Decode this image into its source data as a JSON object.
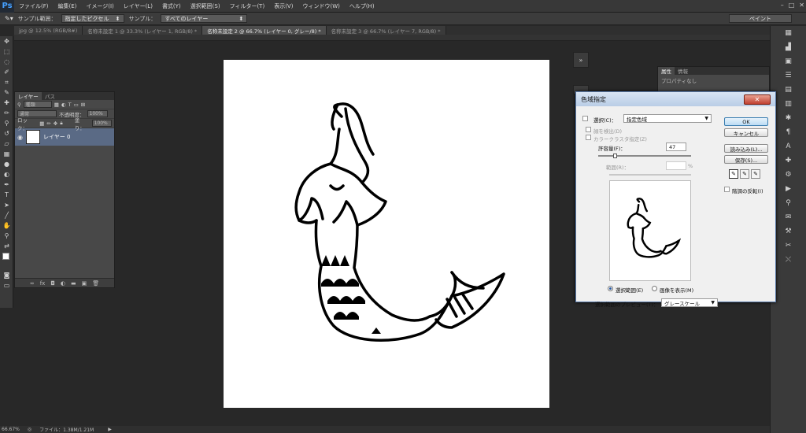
{
  "app": {
    "logo": "Ps"
  },
  "menu": [
    "ファイル(F)",
    "編集(E)",
    "イメージ(I)",
    "レイヤー(L)",
    "書式(Y)",
    "選択範囲(S)",
    "フィルター(T)",
    "表示(V)",
    "ウィンドウ(W)",
    "ヘルプ(H)"
  ],
  "options": {
    "sample_size_label": "サンプル範囲：",
    "sample_size_value": "指定したピクセル",
    "sample_label": "サンプル：",
    "sample_value": "すべてのレイヤー",
    "workspace": "ペイント"
  },
  "tabs": [
    {
      "label": "jpg @ 12.5% (RGB/8#)",
      "active": false
    },
    {
      "label": "名称未設定 1 @ 33.3% (レイヤー 1, RGB/8) *",
      "active": false
    },
    {
      "label": "名称未設定 2 @ 66.7% (レイヤー 0, グレー/8) *",
      "active": true
    },
    {
      "label": "名称未設定 3 @ 66.7% (レイヤー 7, RGB/8) *",
      "active": false
    }
  ],
  "layers_panel": {
    "tabs": [
      "レイヤー",
      "パス"
    ],
    "filter_label": "種類",
    "blend_mode": "通常",
    "opacity_label": "不透明度：",
    "opacity_value": "100%",
    "lock_label": "ロック：",
    "fill_label": "塗り：",
    "fill_value": "100%",
    "layer_name": "レイヤー 0",
    "footer_icons": [
      "link-icon",
      "fx-icon",
      "mask-icon",
      "adjustment-icon",
      "folder-icon",
      "new-layer-icon",
      "trash-icon"
    ]
  },
  "properties_panel": {
    "tabs": [
      "属性",
      "情報"
    ],
    "text": "プロパティなし"
  },
  "dialog": {
    "title": "色域指定",
    "select_label": "選択(C)：",
    "select_value": "指定色域",
    "detect_faces": "顔を検出(D)",
    "localized_clusters": "カラークラスタ指定(Z)",
    "fuzziness_label": "許容量(F)：",
    "fuzziness_value": "47",
    "fuzziness_fraction": 0.18,
    "range_label": "範囲(R)：",
    "range_unit": "%",
    "radio_selection": "選択範囲(E)",
    "radio_image": "画像を表示(M)",
    "preview_label": "選択範囲のプレビュー(T)：",
    "preview_value": "グレースケール",
    "ok": "OK",
    "cancel": "キャンセル",
    "load": "読み込み(L)...",
    "save": "保存(S)...",
    "invert": "階調の反転(I)"
  },
  "status": {
    "zoom": "66.67%",
    "file_info": "ファイル：1.38M/1.21M"
  }
}
